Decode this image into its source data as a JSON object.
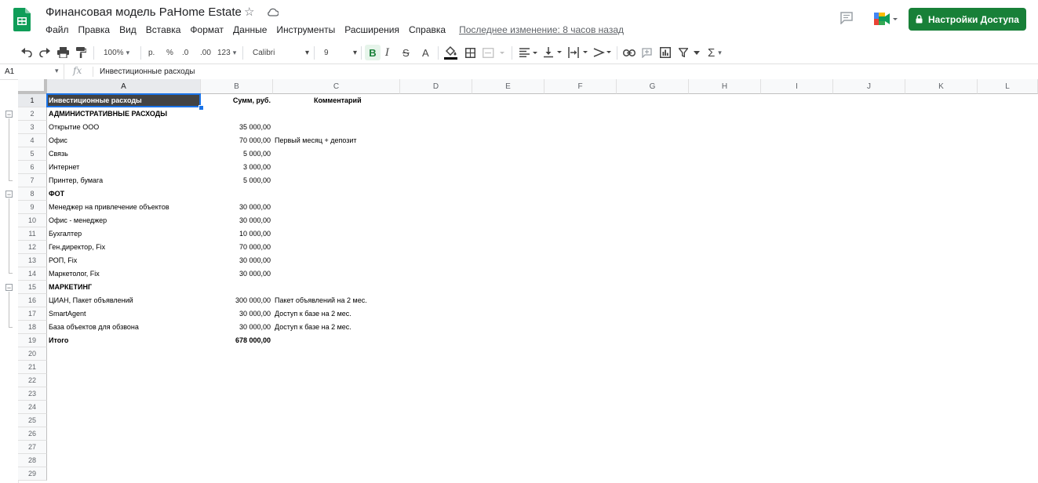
{
  "app": {
    "title": "Финансовая модель PaHome Estate",
    "menu": [
      "Файл",
      "Правка",
      "Вид",
      "Вставка",
      "Формат",
      "Данные",
      "Инструменты",
      "Расширения",
      "Справка"
    ],
    "last_edit": "Последнее изменение: 8 часов назад",
    "share_label": "Настройки Доступа",
    "brand_color": "#188038",
    "accent_color": "#1a73e8"
  },
  "toolbar": {
    "zoom": "100%",
    "currency": "р.",
    "percent": "%",
    "dec_less": ".0",
    "dec_more": ".00",
    "format_more": "123",
    "font": "Calibri",
    "font_size": "9"
  },
  "formula_bar": {
    "cell_ref": "A1",
    "fx": "fx",
    "value": "Инвестиционные расходы"
  },
  "sheet": {
    "columns": [
      "A",
      "B",
      "C",
      "D",
      "E",
      "F",
      "G",
      "H",
      "I",
      "J",
      "K",
      "L"
    ],
    "row_numbers": [
      "1",
      "2",
      "3",
      "4",
      "5",
      "6",
      "7",
      "8",
      "9",
      "10",
      "11",
      "12",
      "13",
      "14",
      "15",
      "16",
      "17",
      "18",
      "19",
      "20",
      "21",
      "22",
      "23",
      "24",
      "25",
      "26",
      "27",
      "28",
      "29"
    ],
    "rows": [
      {
        "a": "Инвестиционные расходы",
        "b": "Сумм, руб.",
        "c": "Комментарий",
        "bold": true
      },
      {
        "a": "АДМИНИСТРАТИВНЫЕ РАСХОДЫ",
        "b": "",
        "c": "",
        "bold": true
      },
      {
        "a": "Открытие ООО",
        "b": "35 000,00",
        "c": "",
        "bold": false
      },
      {
        "a": "Офис",
        "b": "70 000,00",
        "c": "Первый месяц + депозит",
        "bold": false
      },
      {
        "a": "Связь",
        "b": "5 000,00",
        "c": "",
        "bold": false
      },
      {
        "a": "Интернет",
        "b": "3 000,00",
        "c": "",
        "bold": false
      },
      {
        "a": "Принтер, бумага",
        "b": "5 000,00",
        "c": "",
        "bold": false
      },
      {
        "a": "ФОТ",
        "b": "",
        "c": "",
        "bold": true
      },
      {
        "a": "Менеджер на привлечение объектов",
        "b": "30 000,00",
        "c": "",
        "bold": false
      },
      {
        "a": "Офис - менеджер",
        "b": "30 000,00",
        "c": "",
        "bold": false
      },
      {
        "a": "Бухгалтер",
        "b": "10 000,00",
        "c": "",
        "bold": false
      },
      {
        "a": "Ген.директор, Fix",
        "b": "70 000,00",
        "c": "",
        "bold": false
      },
      {
        "a": "РОП, Fix",
        "b": "30 000,00",
        "c": "",
        "bold": false
      },
      {
        "a": "Маркетолог, Fix",
        "b": "30 000,00",
        "c": "",
        "bold": false
      },
      {
        "a": "МАРКЕТИНГ",
        "b": "",
        "c": "",
        "bold": true
      },
      {
        "a": "ЦИАН, Пакет объявлений",
        "b": "300 000,00",
        "c": "Пакет объявлений на 2 мес.",
        "bold": false
      },
      {
        "a": "SmartAgent",
        "b": "30 000,00",
        "c": "Доступ к базе на 2 мес.",
        "bold": false
      },
      {
        "a": "База объектов для обзвона",
        "b": "30 000,00",
        "c": "Доступ к базе на 2 мес.",
        "bold": false
      },
      {
        "a": "Итого",
        "b": "678 000,00",
        "c": "",
        "bold": true
      }
    ]
  }
}
